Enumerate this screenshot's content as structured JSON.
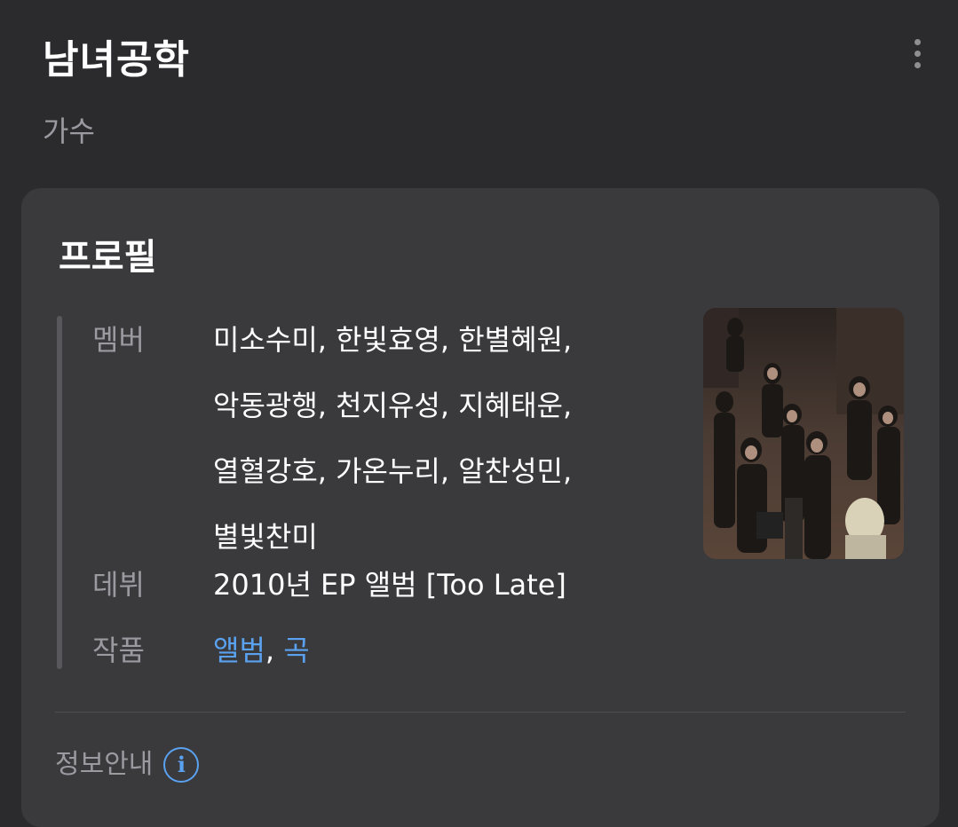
{
  "header": {
    "title": "남녀공학",
    "subtitle": "가수",
    "more_icon": "more-vertical-icon"
  },
  "profile": {
    "heading": "프로필",
    "members_label": "멤버",
    "members_lines": [
      "미소수미, 한빛효영, 한별혜원,",
      "악동광행, 천지유성, 지혜태운,",
      "열혈강호, 가온누리, 알찬성민,",
      "별빛찬미"
    ],
    "debut_label": "데뷔",
    "debut_value": "2010년 EP 앨범 [Too Late]",
    "works_label": "작품",
    "works_link_album": "앨범",
    "works_separator": ",",
    "works_link_song": "곡",
    "link_color": "#5aa2f0"
  },
  "footer": {
    "info_label": "정보안내",
    "info_icon": "info-icon",
    "info_icon_glyph": "i"
  }
}
